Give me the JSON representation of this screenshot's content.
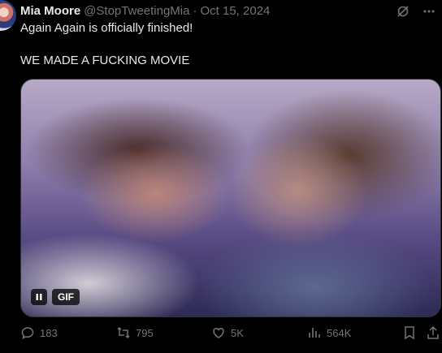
{
  "tweet": {
    "author_name": "Mia Moore",
    "handle": "@StopTweetingMia",
    "separator": "·",
    "date": "Oct 15, 2024",
    "text_line1": "Again Again is officially finished!",
    "text_line2": "WE MADE A FUCKING MOVIE"
  },
  "media": {
    "gif_label": "GIF",
    "state": "playing"
  },
  "actions": {
    "replies": "183",
    "reposts": "795",
    "likes": "5K",
    "views": "564K"
  },
  "icons": {
    "grok": "grok-icon",
    "more": "more-icon",
    "pause": "pause-icon",
    "reply": "reply-icon",
    "repost": "repost-icon",
    "like": "heart-icon",
    "views": "views-icon",
    "bookmark": "bookmark-icon",
    "share": "share-icon"
  },
  "colors": {
    "background": "#000000",
    "text": "#e7e9ea",
    "muted": "#71767b"
  }
}
